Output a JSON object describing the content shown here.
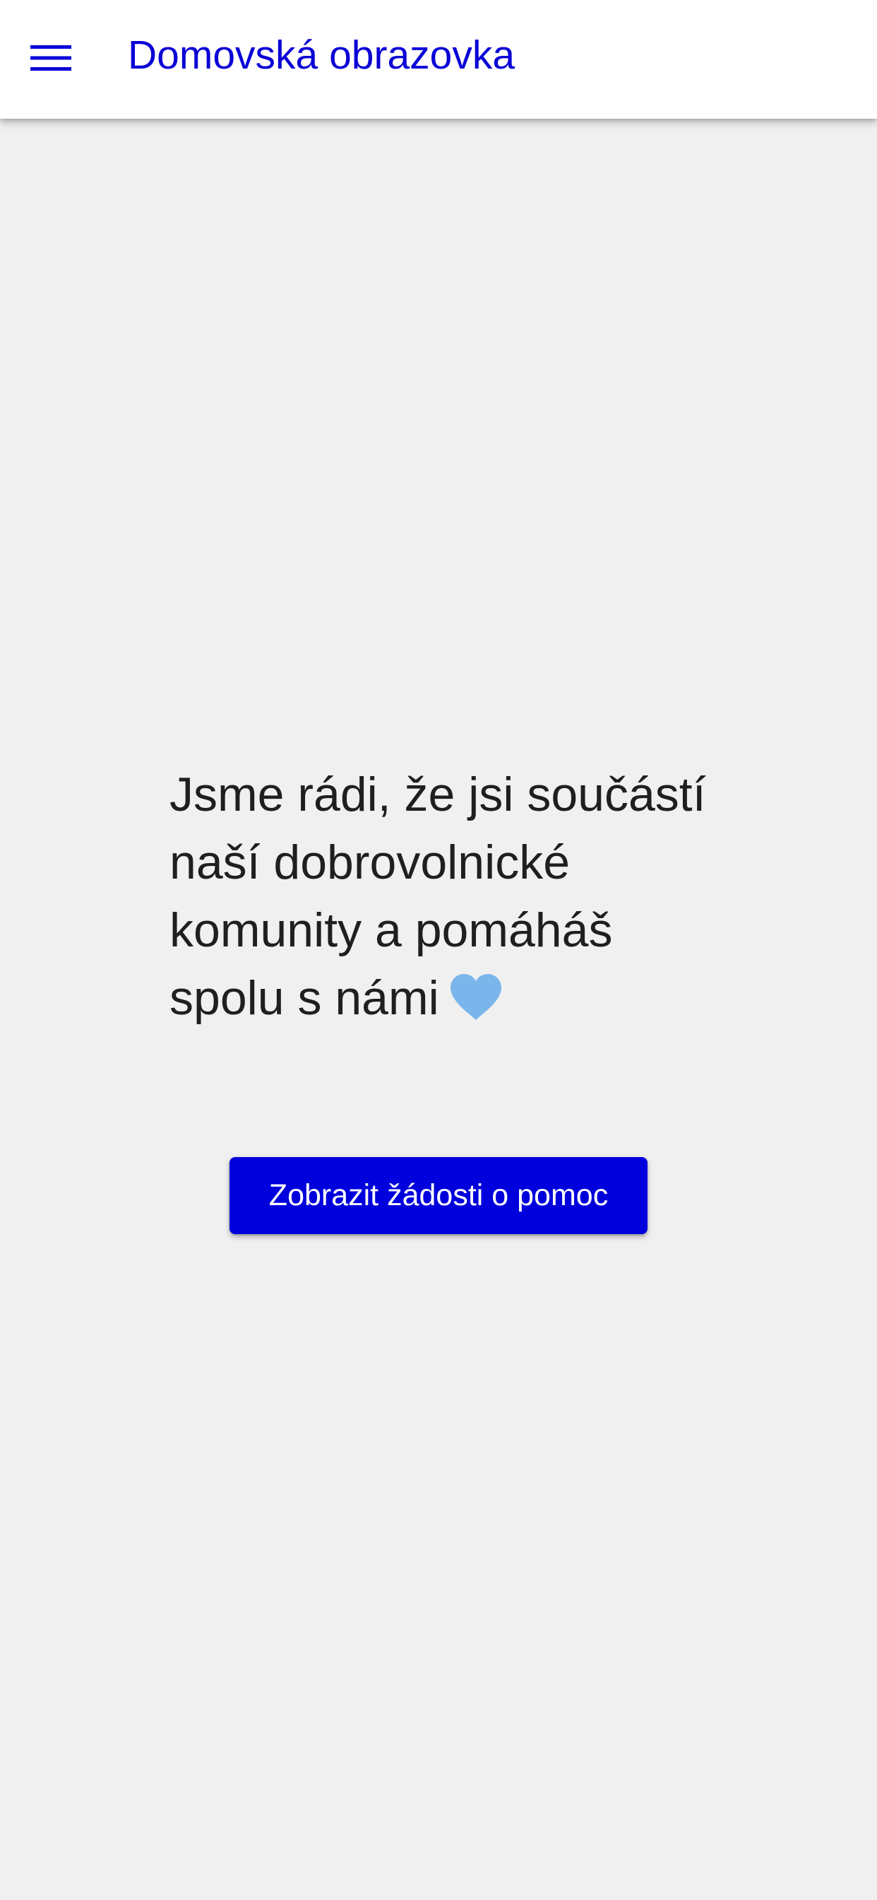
{
  "app_bar": {
    "title": "Domovská obrazovka",
    "menu_icon": "hamburger-menu-icon"
  },
  "main": {
    "welcome_message": "Jsme rádi, že jsi součástí naší dobrovolnické komunity a pomáháš spolu s námi",
    "welcome_icon": "blue-heart-icon",
    "cta_label": "Zobrazit žádosti o pomoc"
  },
  "colors": {
    "primary": "#0000dc",
    "title": "#0a00d6",
    "background": "#f0f0f0",
    "app_bar": "#ffffff",
    "text": "#1f1f1f",
    "heart": "#7ab6ec"
  }
}
